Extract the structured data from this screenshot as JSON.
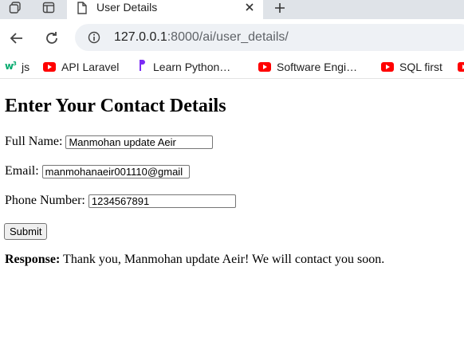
{
  "browser": {
    "tab": {
      "title": "User Details"
    },
    "address": {
      "host": "127.0.0.1",
      "rest": ":8000/ai/user_details/"
    },
    "bookmarks": [
      {
        "label": "js",
        "icon": "w3-icon"
      },
      {
        "label": "API Laravel",
        "icon": "youtube-icon"
      },
      {
        "label": "Learn Python…",
        "icon": "python-icon"
      },
      {
        "label": "Software Engi…",
        "icon": "youtube-icon"
      },
      {
        "label": "SQL first",
        "icon": "youtube-icon"
      }
    ]
  },
  "form": {
    "heading": "Enter Your Contact Details",
    "full_name_label": "Full Name:",
    "full_name_value": "Manmohan update Aeir",
    "email_label": "Email:",
    "email_value": "manmohanaeir001110@gmail",
    "phone_label": "Phone Number:",
    "phone_value": "1234567891",
    "submit_label": "Submit"
  },
  "response": {
    "label": "Response:",
    "text": " Thank you, Manmohan update Aeir! We will contact you soon."
  },
  "colors": {
    "chrome": "#dfe3e8",
    "omnibox": "#eef1f5",
    "youtube": "#ff0000",
    "python": "#7b2cf5"
  }
}
